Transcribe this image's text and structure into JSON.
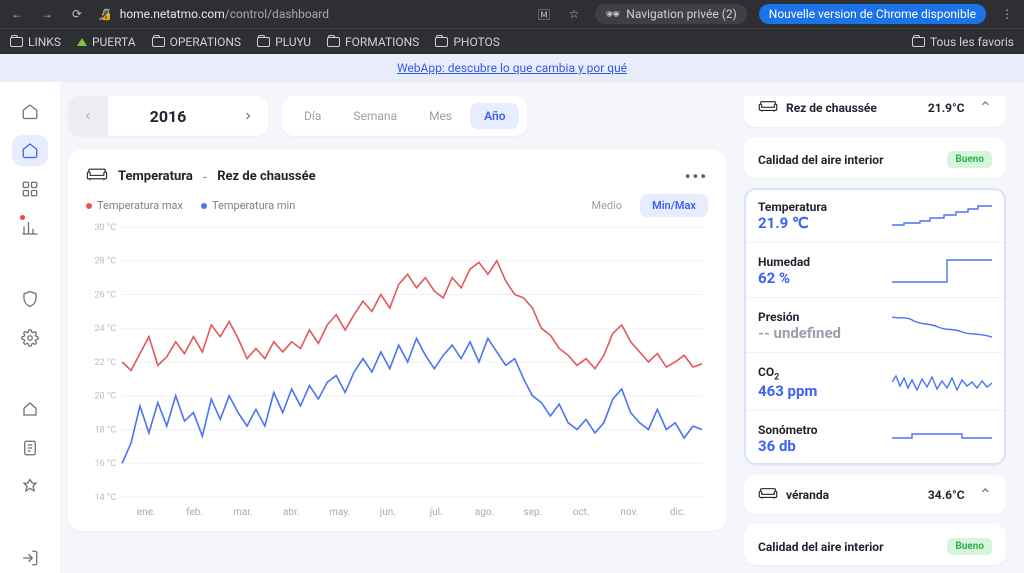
{
  "browser": {
    "url_host": "home.netatmo.com",
    "url_path": "/control/dashboard",
    "private_label": "Navigation privée (2)",
    "update_label": "Nouvelle version de Chrome disponible",
    "bookmarks": [
      "LINKS",
      "PUERTA",
      "OPERATIONS",
      "PLUYU",
      "FORMATIONS",
      "PHOTOS"
    ],
    "all_favs": "Tous les favoris"
  },
  "banner": {
    "text": "WebApp: descubre lo que cambia y por qué"
  },
  "year_nav": {
    "year": "2016"
  },
  "period_tabs": {
    "items": [
      "Día",
      "Semana",
      "Mes",
      "Año"
    ],
    "active": 3
  },
  "chart_card": {
    "title": "Temperatura",
    "sep": "-",
    "room": "Rez de chaussée",
    "legend_max": "Temperatura max",
    "legend_min": "Temperatura min",
    "mode_medio": "Medio",
    "mode_minmax": "Min/Max"
  },
  "right": {
    "room1": {
      "name": "Rez de chaussée",
      "temp": "21.9°C"
    },
    "aq_label": "Calidad del aire interior",
    "aq_badge": "Bueno",
    "metrics": {
      "temp": {
        "name": "Temperatura",
        "val": "21.9 ℃"
      },
      "hum": {
        "name": "Humedad",
        "val": "62 %"
      },
      "press": {
        "name": "Presión",
        "val": "-- undefined"
      },
      "co2": {
        "name": "CO",
        "sub": "2",
        "val": "463 ppm"
      },
      "sono": {
        "name": "Sonómetro",
        "val": "36 db"
      }
    },
    "room2": {
      "name": "véranda",
      "temp": "34.6°C"
    },
    "aq2_label": "Calidad del aire interior",
    "aq2_badge": "Bueno"
  },
  "chart_data": {
    "type": "line",
    "title": "Temperatura - Rez de chaussée (2016)",
    "xlabel": "",
    "ylabel": "°C",
    "ylim": [
      14,
      30
    ],
    "y_ticks": [
      30,
      28,
      26,
      24,
      22,
      20,
      18,
      16,
      14
    ],
    "y_tick_labels": [
      "30 °C",
      "28 °C",
      "26 °C",
      "24 °C",
      "22 °C",
      "20 °C",
      "18 °C",
      "16 °C",
      "14 °C"
    ],
    "categories": [
      "ene.",
      "feb.",
      "mar.",
      "abr.",
      "may.",
      "jun.",
      "jul.",
      "ago.",
      "sep.",
      "oct.",
      "nov.",
      "dic."
    ],
    "series": [
      {
        "name": "Temperatura max",
        "color": "#e45858",
        "values": [
          22.0,
          21.5,
          22.5,
          23.5,
          21.8,
          22.3,
          23.2,
          22.5,
          23.5,
          22.6,
          24.2,
          23.5,
          24.4,
          23.4,
          22.2,
          22.8,
          22.2,
          23.2,
          22.6,
          23.2,
          22.8,
          23.9,
          23.1,
          24.2,
          24.8,
          23.9,
          24.8,
          25.6,
          25.0,
          26.0,
          25.2,
          26.6,
          27.2,
          26.4,
          27.0,
          26.2,
          25.8,
          27.0,
          26.4,
          27.5,
          27.9,
          27.2,
          28.0,
          26.8,
          26.0,
          25.8,
          25.2,
          24.0,
          23.6,
          22.8,
          22.4,
          21.8,
          22.2,
          21.6,
          22.4,
          23.7,
          24.2,
          23.2,
          22.6,
          22.0,
          22.5,
          21.7,
          22.0,
          22.4,
          21.7,
          21.9
        ]
      },
      {
        "name": "Temperatura min",
        "color": "#4a74f3",
        "values": [
          16.0,
          17.2,
          19.4,
          17.8,
          19.6,
          18.2,
          20.0,
          18.5,
          19.0,
          17.6,
          19.8,
          18.6,
          20.0,
          19.0,
          18.2,
          19.2,
          18.2,
          20.2,
          19.0,
          20.4,
          19.4,
          20.6,
          19.8,
          20.8,
          21.2,
          20.2,
          21.4,
          22.2,
          21.4,
          22.6,
          21.6,
          23.0,
          22.0,
          23.4,
          22.4,
          21.6,
          22.4,
          23.0,
          22.2,
          23.2,
          22.0,
          23.4,
          22.6,
          21.8,
          22.2,
          21.0,
          20.0,
          19.6,
          18.8,
          19.5,
          18.4,
          18.0,
          18.6,
          17.8,
          18.4,
          19.8,
          20.4,
          19.0,
          18.4,
          18.0,
          19.2,
          18.0,
          18.4,
          17.5,
          18.2,
          18.0
        ]
      }
    ]
  }
}
